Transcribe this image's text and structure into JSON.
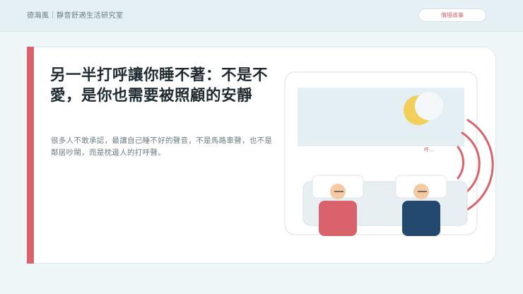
{
  "header": {
    "brand": "德瀚風｜靜音舒適生活研究室",
    "nav_button_label": "情境故事"
  },
  "article": {
    "headline": "另一半打呼讓你睡不著：不是不愛，是你也需要被照顧的安靜",
    "body": "很多人不敢承認，最讓自己睡不好的聲音，不是馬路車聲，也不是鄰居吵鬧，而是枕邊人的打呼聲。"
  },
  "illustration": {
    "snore_text": "呼...",
    "colors": {
      "accent": "#d9636c",
      "partner_left_body": "#d9636c",
      "partner_right_body": "#234a6e",
      "moon": "#f2cf5b",
      "sky": "#e4eff4",
      "skin": "#f5c9a2"
    }
  }
}
